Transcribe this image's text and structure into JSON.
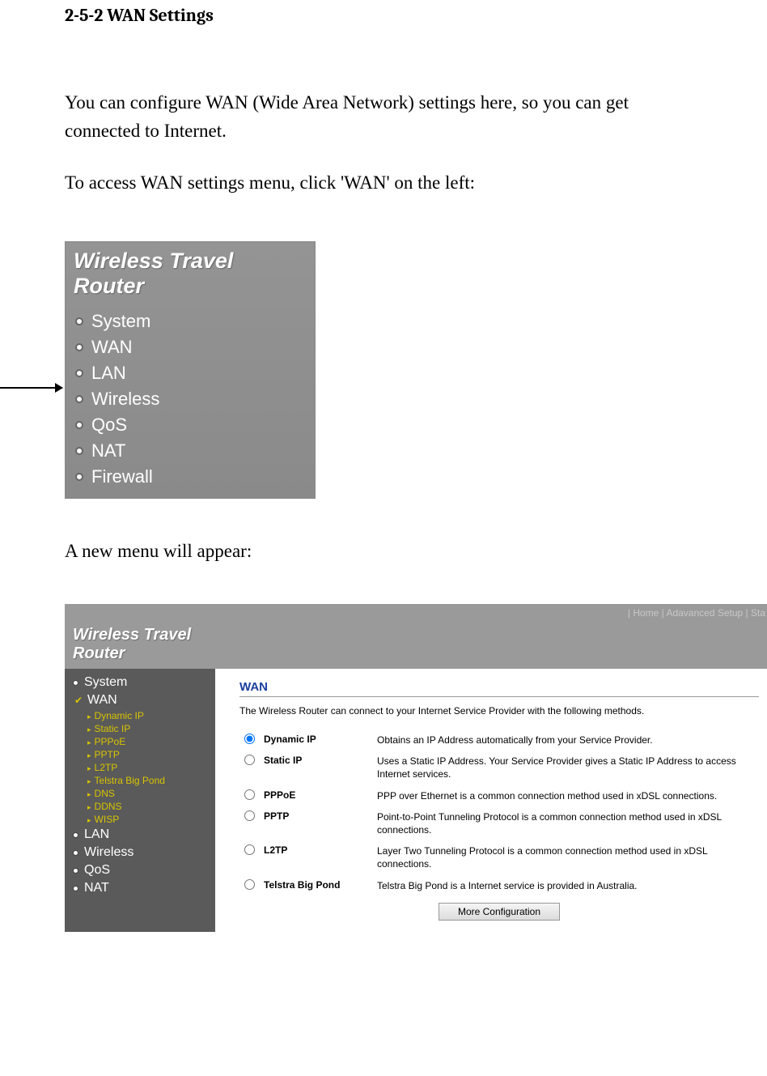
{
  "heading": "2-5-2 WAN Settings",
  "intro1": "You can configure WAN (Wide Area Network) settings here, so you can get connected to Internet.",
  "intro2": "To access WAN settings menu, click 'WAN' on the left:",
  "intro3": "A new menu will appear:",
  "fig1": {
    "title_line1": "Wireless Travel",
    "title_line2": "Router",
    "items": [
      "System",
      "WAN",
      "LAN",
      "Wireless",
      "QoS",
      "NAT",
      "Firewall"
    ]
  },
  "fig2": {
    "topbar": "| Home | Adavanced Setup | Sta",
    "title_line1": "Wireless Travel",
    "title_line2": "Router",
    "sidebar": {
      "main1": "System",
      "selected": "WAN",
      "subs": [
        "Dynamic IP",
        "Static IP",
        "PPPoE",
        "PPTP",
        "L2TP",
        "Telstra Big Pond",
        "DNS",
        "DDNS",
        "WISP"
      ],
      "rest": [
        "LAN",
        "Wireless",
        "QoS",
        "NAT"
      ]
    },
    "content": {
      "title": "WAN",
      "desc": "The Wireless Router can connect to your Internet Service Provider with the following methods.",
      "options": [
        {
          "name": "Dynamic IP",
          "desc": "Obtains an IP Address automatically from your Service Provider.",
          "checked": true
        },
        {
          "name": "Static IP",
          "desc": "Uses a Static IP Address. Your Service Provider gives a Static IP Address to access Internet services.",
          "checked": false
        },
        {
          "name": "PPPoE",
          "desc": "PPP over Ethernet is a common connection method used in xDSL connections.",
          "checked": false
        },
        {
          "name": "PPTP",
          "desc": "Point-to-Point Tunneling Protocol is a common connection method used in xDSL connections.",
          "checked": false
        },
        {
          "name": "L2TP",
          "desc": "Layer Two Tunneling Protocol is a common connection method used in xDSL connections.",
          "checked": false
        },
        {
          "name": "Telstra Big Pond",
          "desc": "Telstra Big Pond is a Internet service is provided in Australia.",
          "checked": false
        }
      ],
      "button": "More Configuration"
    }
  }
}
